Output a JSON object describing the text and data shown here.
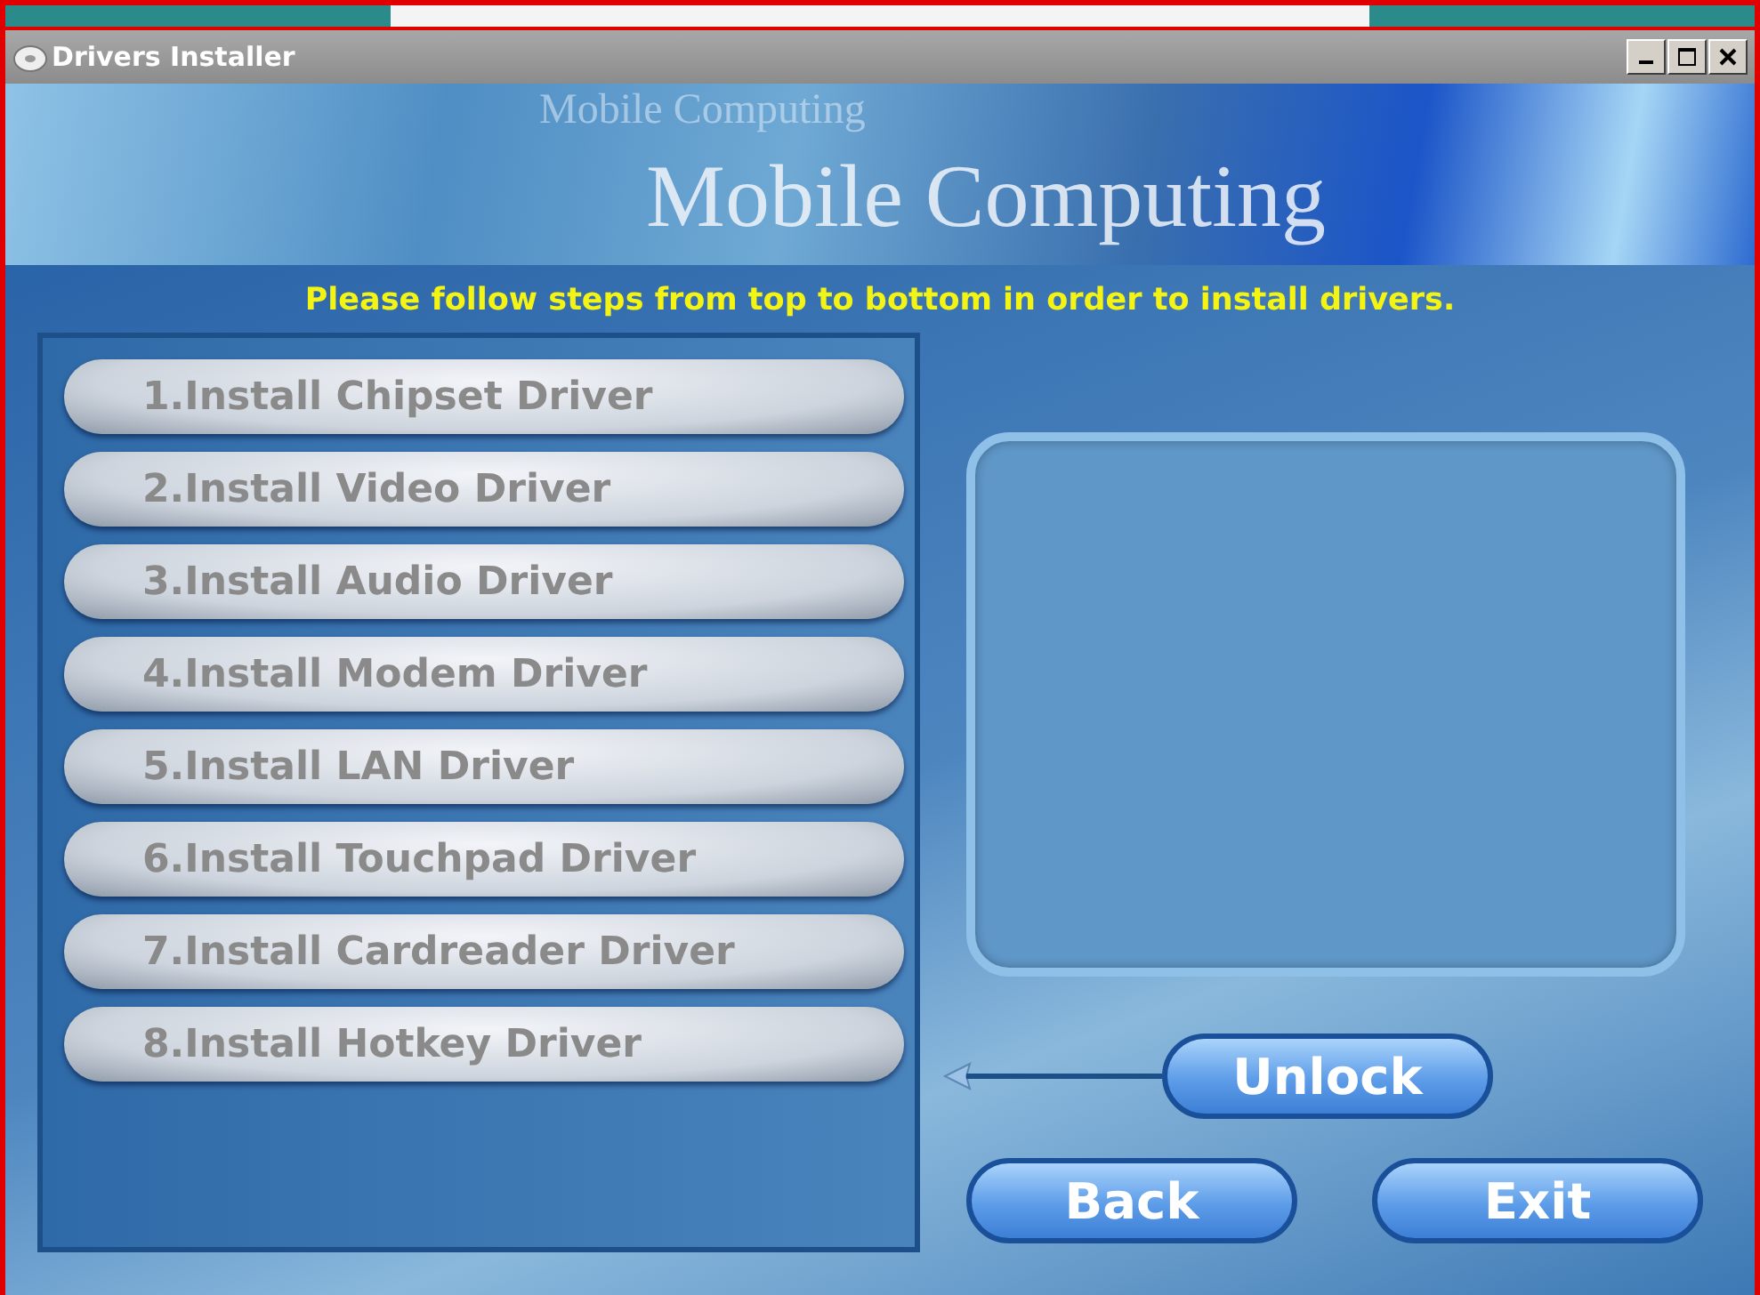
{
  "window": {
    "title": "Drivers Installer"
  },
  "banner": {
    "subtitle": "Mobile Computing",
    "title": "Mobile Computing"
  },
  "instruction": "Please follow steps from top to bottom in order to install drivers.",
  "steps": [
    {
      "label": "1.Install Chipset Driver",
      "disabled": true
    },
    {
      "label": "2.Install Video Driver",
      "disabled": true
    },
    {
      "label": "3.Install Audio Driver",
      "disabled": true
    },
    {
      "label": "4.Install Modem Driver",
      "disabled": true
    },
    {
      "label": "5.Install LAN Driver",
      "disabled": true
    },
    {
      "label": "6.Install Touchpad Driver",
      "disabled": true
    },
    {
      "label": "7.Install Cardreader Driver",
      "disabled": true
    },
    {
      "label": "8.Install Hotkey Driver",
      "disabled": true
    }
  ],
  "unlock_button": "Unlock",
  "buttons": [
    "Back",
    "Exit"
  ]
}
